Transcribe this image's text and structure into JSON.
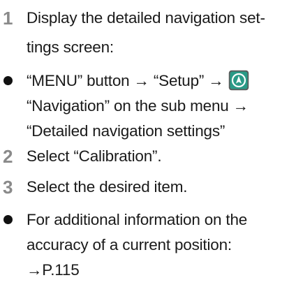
{
  "steps": [
    {
      "number": "1",
      "lines": [
        "Display the detailed navigation set-",
        "tings screen:"
      ]
    },
    {
      "number": "2",
      "lines": [
        "Select “Calibration”."
      ]
    },
    {
      "number": "3",
      "lines": [
        "Select the desired item."
      ]
    }
  ],
  "bullets": [
    {
      "lines": [
        "“MENU” button → “Setup” →",
        "“Navigation” on the sub menu →",
        "“Detailed navigation settings”"
      ],
      "icon": "navigation-icon"
    },
    {
      "lines": [
        "For additional information on the",
        "accuracy of a current position:",
        "→P.115"
      ]
    }
  ],
  "colors": {
    "step_number": "#8a8a8a",
    "icon_background": "#2a9a86",
    "icon_border": "#5b5b5b",
    "text": "#1a1a1a"
  }
}
